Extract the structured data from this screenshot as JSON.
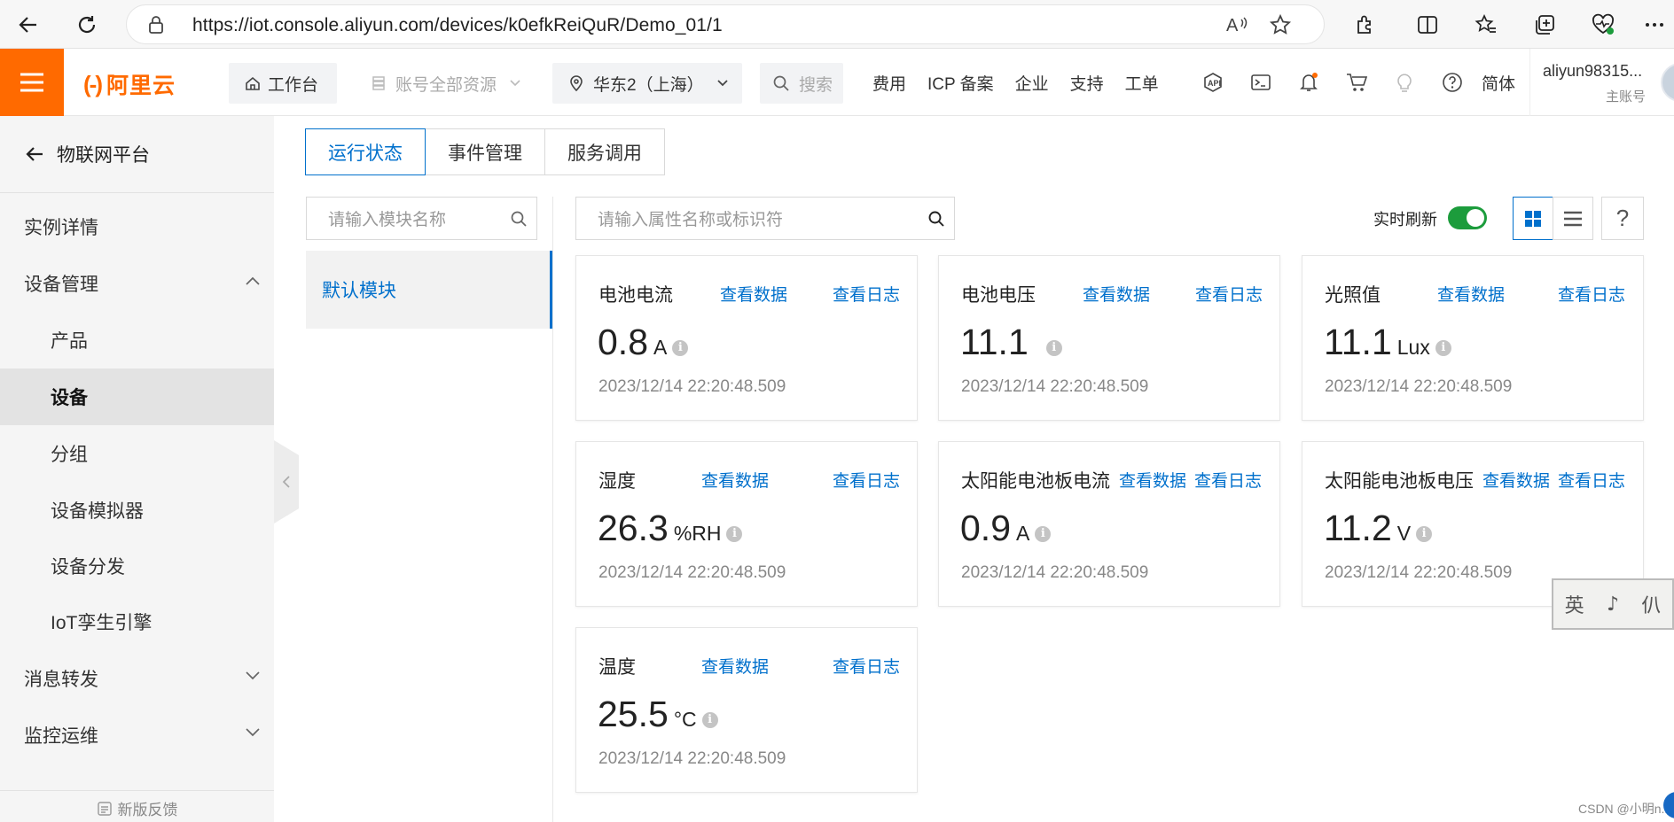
{
  "browser": {
    "url": "https://iot.console.aliyun.com/devices/k0efkReiQuR/Demo_01/1"
  },
  "topnav": {
    "logo": "阿里云",
    "workbench": "工作台",
    "resources": "账号全部资源",
    "region": "华东2（上海）",
    "search_placeholder": "搜索",
    "links": [
      "费用",
      "ICP 备案",
      "企业",
      "支持",
      "工单"
    ],
    "lang": "简体",
    "account_name": "aliyun98315...",
    "account_role": "主账号"
  },
  "sidebar": {
    "back_label": "物联网平台",
    "items": [
      {
        "label": "实例详情"
      },
      {
        "label": "设备管理"
      },
      {
        "label": "产品"
      },
      {
        "label": "设备"
      },
      {
        "label": "分组"
      },
      {
        "label": "设备模拟器"
      },
      {
        "label": "设备分发"
      },
      {
        "label": "IoT孪生引擎"
      },
      {
        "label": "消息转发"
      },
      {
        "label": "监控运维"
      }
    ],
    "footer": "新版反馈"
  },
  "tabs": [
    "运行状态",
    "事件管理",
    "服务调用"
  ],
  "module_search_placeholder": "请输入模块名称",
  "property_search_placeholder": "请输入属性名称或标识符",
  "module_default": "默认模块",
  "realtime_label": "实时刷新",
  "realtime_enabled": true,
  "help_label": "?",
  "card_links": {
    "data": "查看数据",
    "log": "查看日志"
  },
  "properties": [
    {
      "name": "电池电流",
      "value": "0.8",
      "unit": "A",
      "time": "2023/12/14 22:20:48.509"
    },
    {
      "name": "电池电压",
      "value": "11.1",
      "unit": "",
      "time": "2023/12/14 22:20:48.509"
    },
    {
      "name": "光照值",
      "value": "11.1",
      "unit": "Lux",
      "time": "2023/12/14 22:20:48.509"
    },
    {
      "name": "湿度",
      "value": "26.3",
      "unit": "%RH",
      "time": "2023/12/14 22:20:48.509"
    },
    {
      "name": "太阳能电池板电流",
      "value": "0.9",
      "unit": "A",
      "time": "2023/12/14 22:20:48.509"
    },
    {
      "name": "太阳能电池板电压",
      "value": "11.2",
      "unit": "V",
      "time": "2023/12/14 22:20:48.509"
    },
    {
      "name": "温度",
      "value": "25.5",
      "unit": "°C",
      "time": "2023/12/14 22:20:48.509"
    }
  ],
  "ime_stamp": [
    "英",
    "♪",
    "仈"
  ],
  "watermark": "CSDN @小明n.n",
  "colors": {
    "brand": "#ff6a00",
    "link": "#0070cc",
    "toggle_on": "#1c9c3c"
  }
}
